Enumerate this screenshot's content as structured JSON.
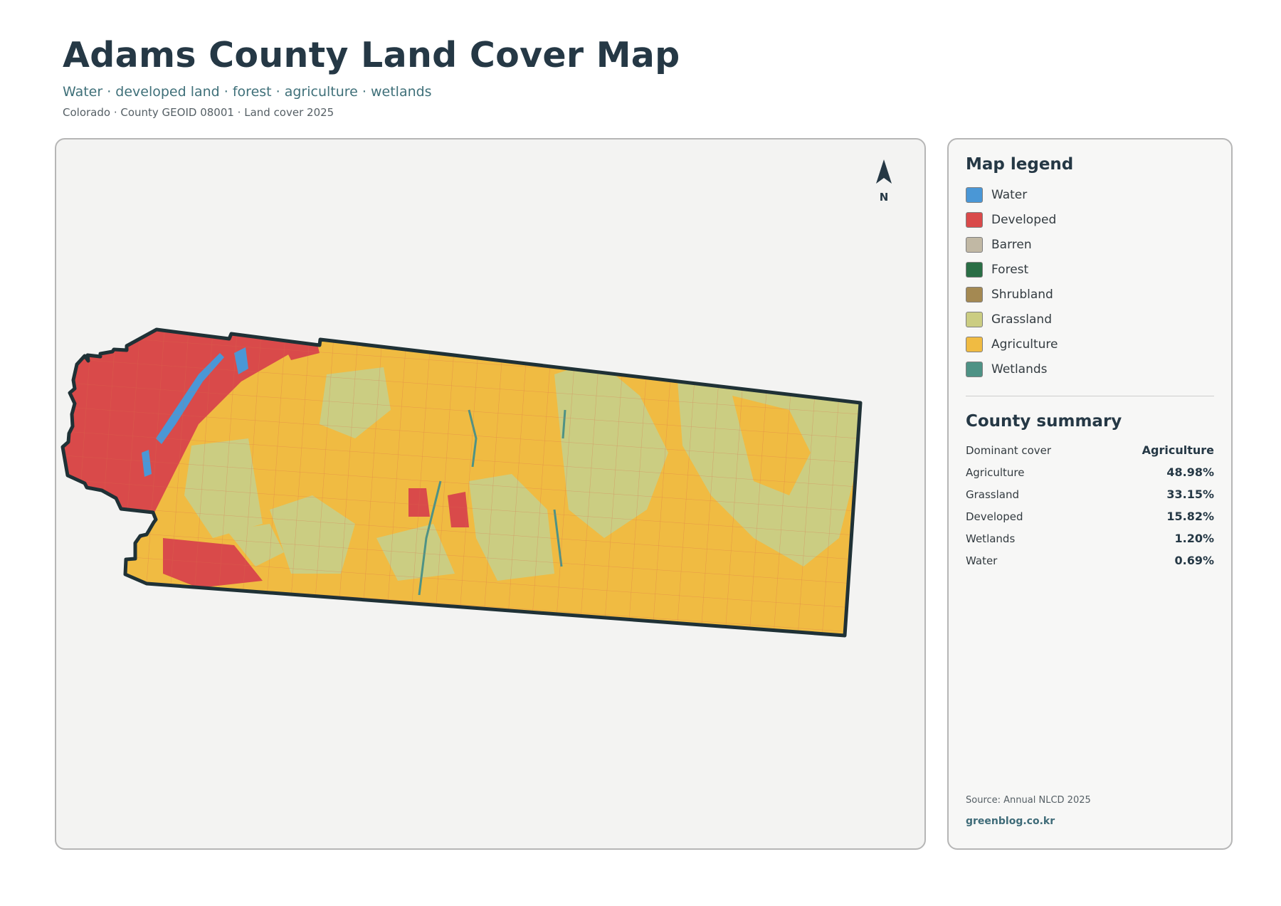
{
  "header": {
    "title": "Adams County Land Cover Map",
    "subtitle": "Water · developed land · forest · agriculture · wetlands",
    "meta": "Colorado · County GEOID 08001 · Land cover 2025"
  },
  "compass": {
    "label": "N",
    "icon": "north-arrow-icon"
  },
  "legend": {
    "title": "Map legend",
    "items": [
      {
        "label": "Water",
        "color": "#4a97d6"
      },
      {
        "label": "Developed",
        "color": "#d94a4a"
      },
      {
        "label": "Barren",
        "color": "#c1b8a4"
      },
      {
        "label": "Forest",
        "color": "#2a6e45"
      },
      {
        "label": "Shrubland",
        "color": "#a48952"
      },
      {
        "label": "Grassland",
        "color": "#cbcd82"
      },
      {
        "label": "Agriculture",
        "color": "#f0bb42"
      },
      {
        "label": "Wetlands",
        "color": "#4e9285"
      }
    ]
  },
  "summary": {
    "title": "County summary",
    "rows": [
      {
        "key": "Dominant cover",
        "value": "Agriculture"
      },
      {
        "key": "Agriculture",
        "value": "48.98%"
      },
      {
        "key": "Grassland",
        "value": "33.15%"
      },
      {
        "key": "Developed",
        "value": "15.82%"
      },
      {
        "key": "Wetlands",
        "value": "1.20%"
      },
      {
        "key": "Water",
        "value": "0.69%"
      }
    ]
  },
  "footer": {
    "source": "Source: Annual NLCD 2025",
    "site": "greenblog.co.kr"
  },
  "map": {
    "outline_color": "#1f3136",
    "background": "#f3f3f2"
  }
}
